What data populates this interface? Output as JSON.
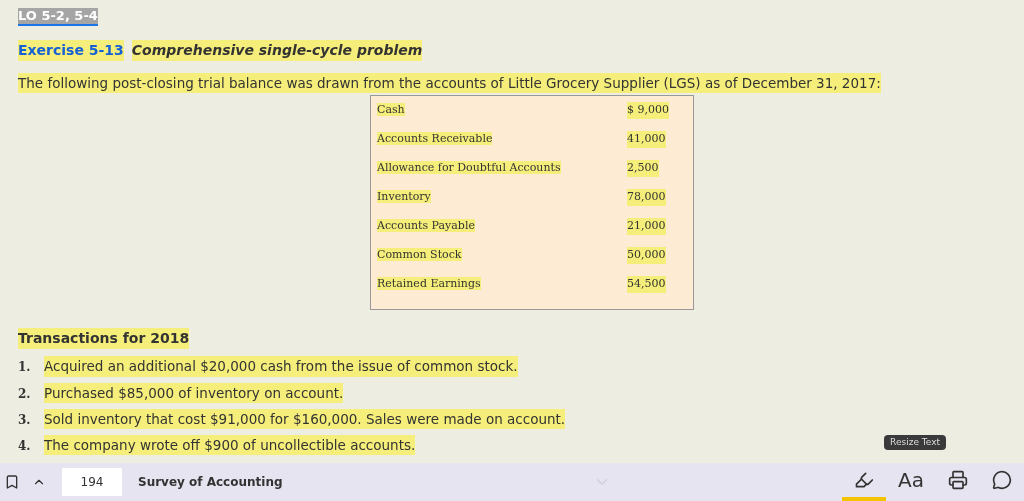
{
  "lo_tag": "LO 5-2, 5-4",
  "exercise": {
    "number": "Exercise 5-13",
    "title": "Comprehensive single-cycle problem"
  },
  "intro": "The following post-closing trial balance was drawn from the accounts of Little Grocery Supplier (LGS) as of December 31, 2017:",
  "trial_balance": [
    {
      "account": "Cash",
      "amount": "$ 9,000"
    },
    {
      "account": "Accounts Receivable",
      "amount": "41,000"
    },
    {
      "account": "Allowance for Doubtful Accounts",
      "amount": "2,500"
    },
    {
      "account": "Inventory",
      "amount": "78,000"
    },
    {
      "account": "Accounts Payable",
      "amount": "21,000"
    },
    {
      "account": "Common Stock",
      "amount": "50,000"
    },
    {
      "account": "Retained Earnings",
      "amount": "54,500"
    }
  ],
  "transactions_heading": "Transactions for 2018",
  "transactions": [
    {
      "number": "1.",
      "text": "Acquired an additional $20,000 cash from the issue of common stock."
    },
    {
      "number": "2.",
      "text": "Purchased $85,000 of inventory on account."
    },
    {
      "number": "3.",
      "text": "Sold inventory that cost $91,000 for $160,000. Sales were made on account."
    },
    {
      "number": "4.",
      "text": "The company wrote off $900 of uncollectible accounts."
    }
  ],
  "tooltip": "Resize Text",
  "toolbar": {
    "page": "194",
    "book_title": "Survey of Accounting",
    "tools": [
      {
        "kind": "highlight",
        "selected": true
      },
      {
        "kind": "text",
        "label": "Aa",
        "selected": false
      },
      {
        "kind": "print",
        "selected": false
      },
      {
        "kind": "quote",
        "selected": false
      }
    ]
  }
}
